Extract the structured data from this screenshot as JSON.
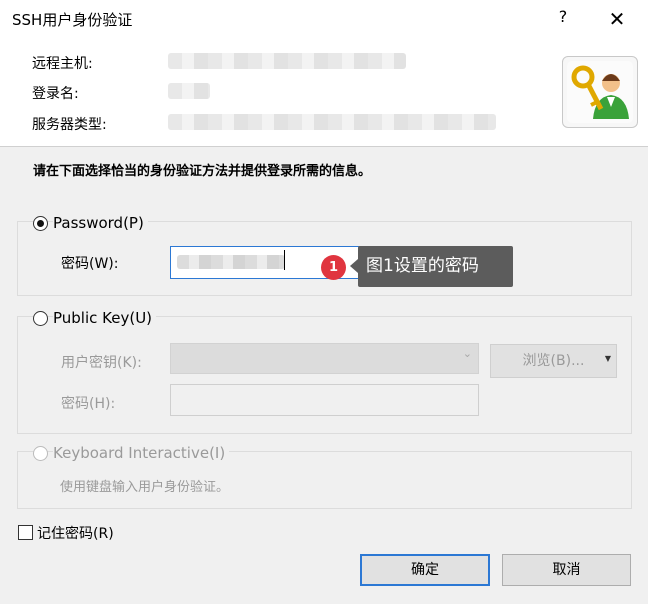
{
  "window": {
    "title": "SSH用户身份验证",
    "help_glyph": "?",
    "close_glyph": "✕"
  },
  "header": {
    "remote_host_label": "远程主机:",
    "login_name_label": "登录名:",
    "server_type_label": "服务器类型:",
    "icon": "key-user-icon"
  },
  "instruction": "请在下面选择恰当的身份验证方法并提供登录所需的信息。",
  "password_method": {
    "label": "Password(P)",
    "selected": true,
    "field_label": "密码(W):"
  },
  "publickey_method": {
    "label": "Public Key(U)",
    "selected": false,
    "user_key_label": "用户密钥(K):",
    "passphrase_label": "密码(H):",
    "browse_label": "浏览(B)..."
  },
  "keyboard_method": {
    "label": "Keyboard Interactive(I)",
    "selected": false,
    "description": "使用键盘输入用户身份验证。"
  },
  "remember_password": {
    "label": "记住密码(R)",
    "checked": false
  },
  "buttons": {
    "ok": "确定",
    "cancel": "取消"
  },
  "annotation": {
    "badge": "1",
    "text": "图1设置的密码"
  },
  "colors": {
    "accent": "#2c78d4",
    "badge": "#e0353f",
    "tooltip_bg": "#5c5c5c"
  }
}
